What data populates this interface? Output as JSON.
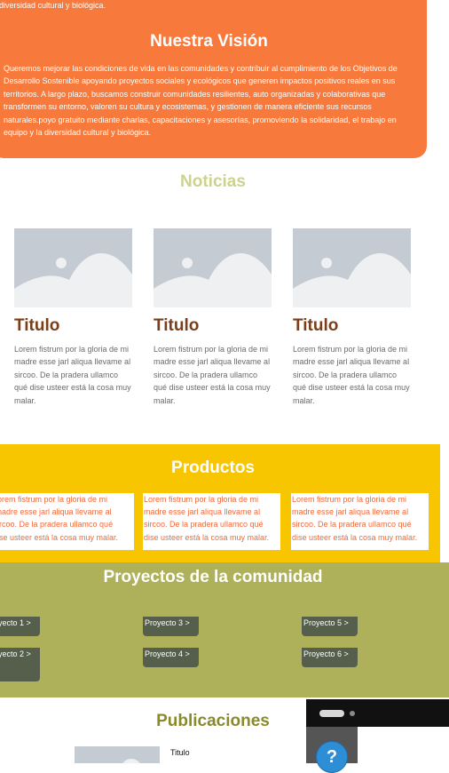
{
  "vision": {
    "previous_text": "diversidad cultural y biológica.",
    "title": "Nuestra Visión",
    "body": "Queremos mejorar las condiciones de vida en las comunidades y contribuir al cumplimiento de los Objetivos de Desarrollo Sostenible apoyando proyectos sociales y ecológicos que generen impactos positivos reales en sus territorios. A largo plazo, buscamos construir comunidades resilientes, auto organizadas y colaborativas que transformen su entorno, valoren su cultura y ecosistemas, y gestionen de manera eficiente sus recursos naturales.poyo gratuito mediante charlas, capacitaciones y asesorías, promoviendo la solidaridad, el trabajo en equipo y la diversidad cultural y biológica.",
    "bg_color": "#f77a3c"
  },
  "news": {
    "title": "Noticias",
    "cards": [
      {
        "title": "Titulo",
        "text": "Lorem fistrum por la gloria de mi madre esse jarl aliqua llevame al sircoo. De la pradera ullamco qué dise usteer está la cosa muy malar.",
        "image_icon": "image-placeholder-icon"
      },
      {
        "title": "Titulo",
        "text": "Lorem fistrum por la gloria de mi madre esse jarl aliqua llevame al sircoo. De la pradera ullamco qué dise usteer está la cosa muy malar.",
        "image_icon": "image-placeholder-icon"
      },
      {
        "title": "Titulo",
        "text": "Lorem fistrum por la gloria de mi madre esse jarl aliqua llevame al sircoo. De la pradera ullamco qué dise usteer está la cosa muy malar.",
        "image_icon": "image-placeholder-icon"
      }
    ]
  },
  "products": {
    "title": "Productos",
    "bg_color": "#f7c600",
    "items": [
      {
        "line1": "orem fistrum por la gloria de mi",
        "line2": "nadre esse jarl aliqua llevame al",
        "line3": "ircoo. De la pradera ullamco qué",
        "line4": "ise usteer está la cosa muy malar."
      },
      {
        "line1": "Lorem fistrum por la gloria de mi",
        "line2": "madre esse jarl aliqua llevame al",
        "line3": "sircoo. De la pradera ullamco qué",
        "line4": "dise usteer está la cosa muy malar."
      },
      {
        "line1": "Lorem fistrum por la gloria de mi",
        "line2": "madre esse jarl aliqua llevame al",
        "line3": "sircoo. De la pradera ullamco qué",
        "line4": "dise usteer está la cosa muy malar."
      }
    ]
  },
  "projects": {
    "title": "Proyectos de la comunidad",
    "bg_color": "#aeb15a",
    "buttons": {
      "p1": "yecto 1  >",
      "p2": "yecto 2  >",
      "p3": "Proyecto 3  >",
      "p4": "Proyecto 4  >",
      "p5": "Proyecto 5 >",
      "p6": "Proyecto 6  >"
    }
  },
  "publications": {
    "title": "Publicaciones",
    "first_item_title": "Titulo"
  },
  "widget": {
    "help_label": "?",
    "help_icon": "help-icon"
  }
}
